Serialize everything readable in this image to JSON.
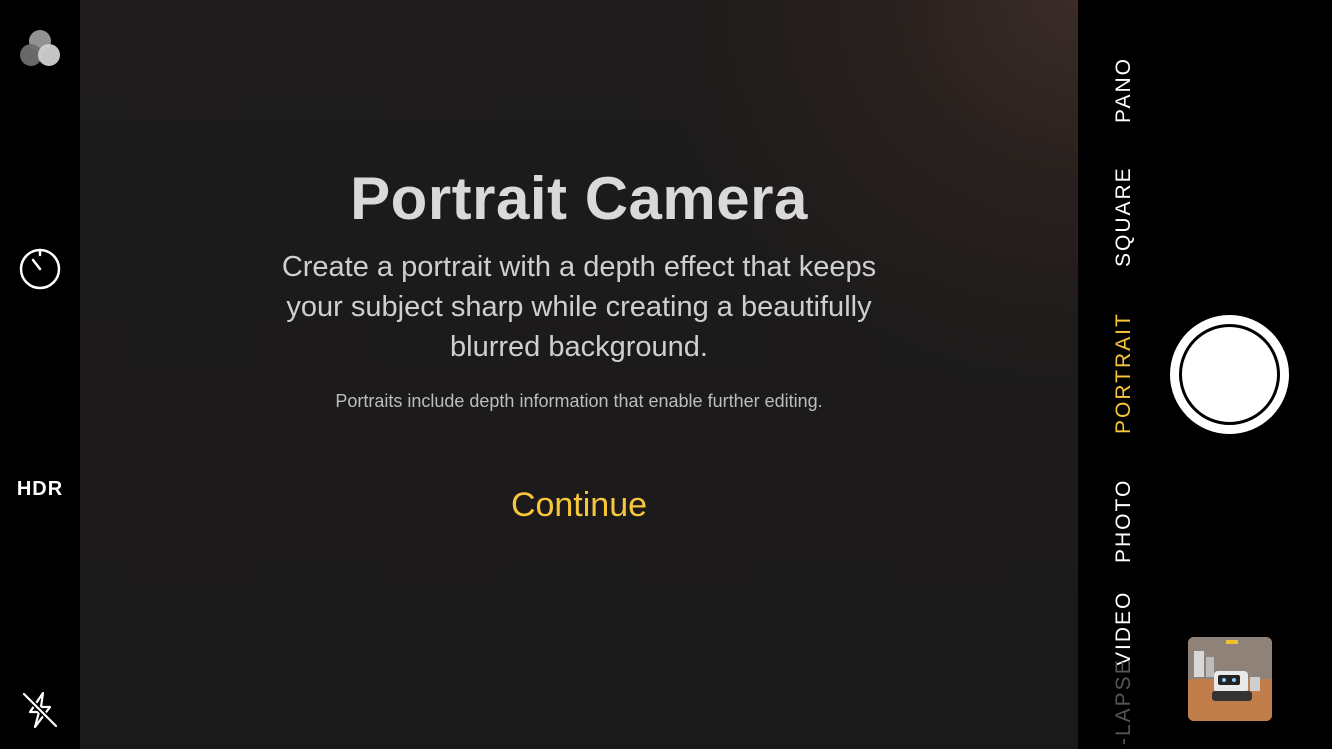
{
  "left_bar": {
    "filters_icon": "filters-icon",
    "timer_icon": "timer-icon",
    "hdr_label": "HDR",
    "flash_icon": "flash-off-icon"
  },
  "intro": {
    "title": "Portrait Camera",
    "body": "Create a portrait with a depth effect that keeps your subject sharp while creating a beautifully blurred background.",
    "note": "Portraits include depth information that enable further editing.",
    "continue_label": "Continue"
  },
  "modes": [
    {
      "label": "PANO",
      "state": "normal"
    },
    {
      "label": "SQUARE",
      "state": "normal"
    },
    {
      "label": "PORTRAIT",
      "state": "active"
    },
    {
      "label": "PHOTO",
      "state": "normal"
    },
    {
      "label": "VIDEO",
      "state": "normal"
    },
    {
      "label": "-LAPSE",
      "state": "faded"
    }
  ],
  "colors": {
    "accent": "#f7c63a",
    "text": "#ffffff"
  }
}
